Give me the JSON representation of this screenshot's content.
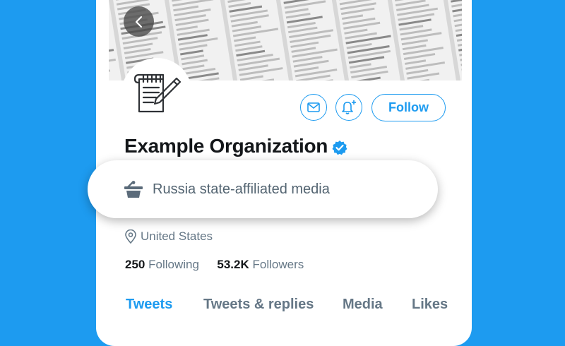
{
  "profile": {
    "name": "Example Organization",
    "verified": true,
    "state_label": "Russia state-affiliated media",
    "location": "United States",
    "following_count": "250",
    "following_label": "Following",
    "followers_count": "53.2K",
    "followers_label": "Followers"
  },
  "actions": {
    "follow_label": "Follow",
    "message_icon": "mail-icon",
    "notify_icon": "bell-plus-icon"
  },
  "tabs": [
    {
      "label": "Tweets",
      "active": true
    },
    {
      "label": "Tweets & replies",
      "active": false
    },
    {
      "label": "Media",
      "active": false
    },
    {
      "label": "Likes",
      "active": false
    }
  ],
  "colors": {
    "accent": "#1d9bf0",
    "text_primary": "#14171a",
    "text_secondary": "#657786",
    "label_text": "#536471"
  }
}
